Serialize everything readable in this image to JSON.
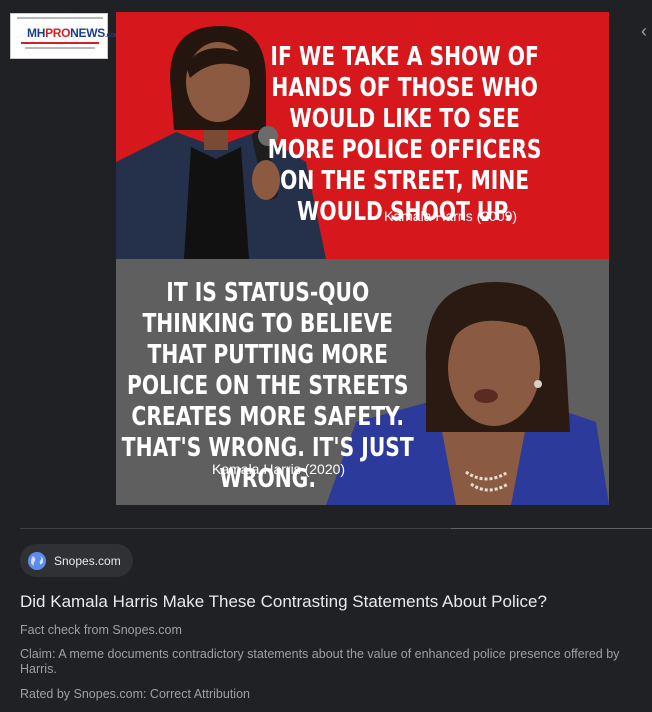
{
  "site_logo": {
    "brand_prefix": "MH",
    "brand_mid": "PRO",
    "brand_suffix": "NEWS",
    "domain_suffix": ".com"
  },
  "meme": {
    "top_quote": "IF WE TAKE A SHOW OF HANDS OF THOSE WHO WOULD LIKE TO SEE MORE POLICE OFFICERS ON THE STREET, MINE WOULD SHOOT UP.",
    "top_attribution": "Kamala Harris (2009)",
    "bottom_quote": "IT IS STATUS-QUO THINKING TO BELIEVE THAT PUTTING MORE POLICE ON THE STREETS CREATES MORE SAFETY. THAT'S WRONG. IT'S JUST WRONG.",
    "bottom_attribution": "Kamala Harris (2020)",
    "colors": {
      "top_panel": "#d6181d",
      "bottom_panel": "#5f5f5f"
    }
  },
  "result": {
    "source_chip": "Snopes.com",
    "source_icon": "globe-icon",
    "title": "Did Kamala Harris Make These Contrasting Statements About Police?",
    "fact_check": "Fact check from Snopes.com",
    "claim": "Claim: A meme documents contradictory statements about the value of enhanced police presence offered by Harris.",
    "rating": "Rated by Snopes.com: Correct Attribution"
  },
  "nav": {
    "prev_icon": "chevron-left-icon"
  },
  "colors": {
    "background": "#202124",
    "primary_text": "#e8eaed",
    "secondary_text": "#9aa0a6",
    "chip": "#303134"
  }
}
